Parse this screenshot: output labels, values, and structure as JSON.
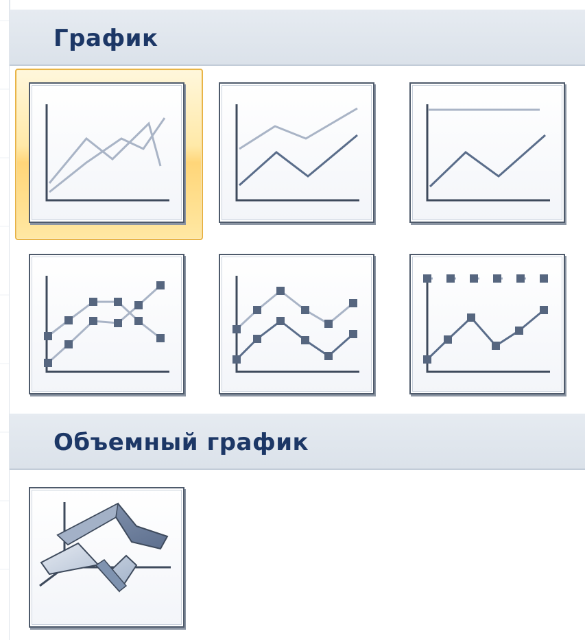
{
  "sections": [
    {
      "title": "График",
      "items": [
        {
          "icon": "line-chart-icon"
        },
        {
          "icon": "stacked-line-chart-icon"
        },
        {
          "icon": "100-percent-stacked-line-chart-icon"
        },
        {
          "icon": "line-with-markers-chart-icon"
        },
        {
          "icon": "stacked-line-with-markers-chart-icon"
        },
        {
          "icon": "100-percent-stacked-line-with-markers-chart-icon"
        }
      ]
    },
    {
      "title": "Объемный график",
      "items": [
        {
          "icon": "3d-line-chart-icon"
        }
      ]
    }
  ],
  "selected_item": "line-chart-icon",
  "colors": {
    "header_text": "#1c3766",
    "header_bg": "#dfe5ec",
    "axis": "#3e4a5c",
    "series_dark": "#5a6d8a",
    "series_light": "#a9b4c6",
    "marker": "#56667f",
    "hover_border": "#e8b447",
    "hover_fill": "#ffe28f"
  }
}
